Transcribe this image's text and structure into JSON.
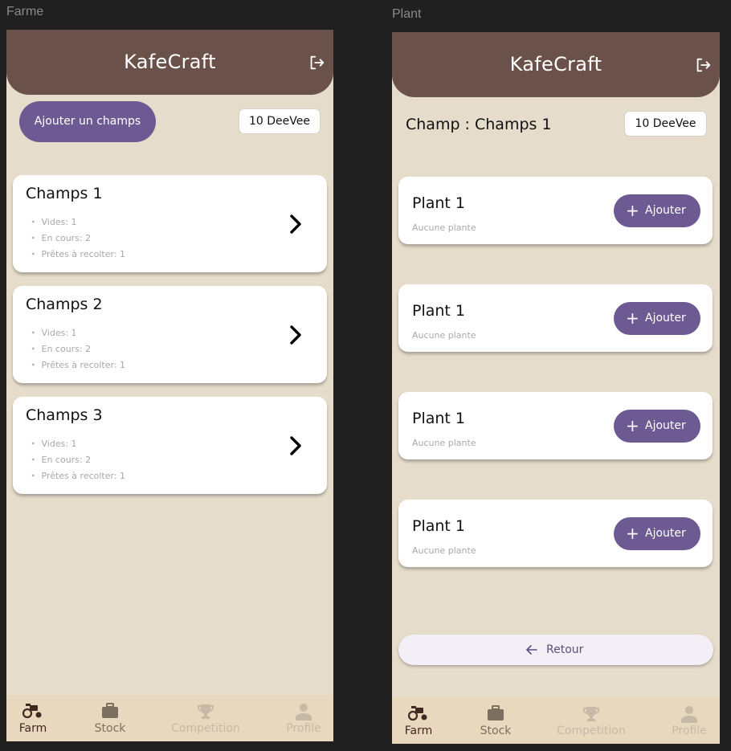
{
  "frames": {
    "farm_label": "Farme",
    "plant_label": "Plant"
  },
  "colors": {
    "appbar": "#6a524a",
    "background": "#e6dccb",
    "primary_button": "#6d5a93",
    "bottom_nav": "#e8d8be"
  },
  "farm_screen": {
    "app_title": "KafeCraft",
    "logout_icon": "logout-icon",
    "add_field_label": "Ajouter un champs",
    "currency": "10 DeeVee",
    "fields": [
      {
        "name": "Champs 1",
        "stats": [
          "Vides: 1",
          "En cours: 2",
          "Prêtes à recolter: 1"
        ]
      },
      {
        "name": "Champs 2",
        "stats": [
          "Vides: 1",
          "En cours: 2",
          "Prêtes à recolter: 1"
        ]
      },
      {
        "name": "Champs 3",
        "stats": [
          "Vides: 1",
          "En cours: 2",
          "Prêtes à recolter: 1"
        ]
      }
    ]
  },
  "plant_screen": {
    "app_title": "KafeCraft",
    "heading": "Champ : Champs 1",
    "currency": "10 DeeVee",
    "plants": [
      {
        "name": "Plant 1",
        "status": "Aucune plante",
        "button": "Ajouter"
      },
      {
        "name": "Plant 1",
        "status": "Aucune plante",
        "button": "Ajouter"
      },
      {
        "name": "Plant 1",
        "status": "Aucune plante",
        "button": "Ajouter"
      },
      {
        "name": "Plant 1",
        "status": "Aucune plante",
        "button": "Ajouter"
      }
    ],
    "back_label": "Retour"
  },
  "bottom_nav": [
    {
      "label": "Farm",
      "icon": "tractor-icon",
      "active": true
    },
    {
      "label": "Stock",
      "icon": "briefcase-icon",
      "active": false
    },
    {
      "label": "Competition",
      "icon": "trophy-icon",
      "active": false
    },
    {
      "label": "Profile",
      "icon": "person-icon",
      "active": false
    }
  ]
}
